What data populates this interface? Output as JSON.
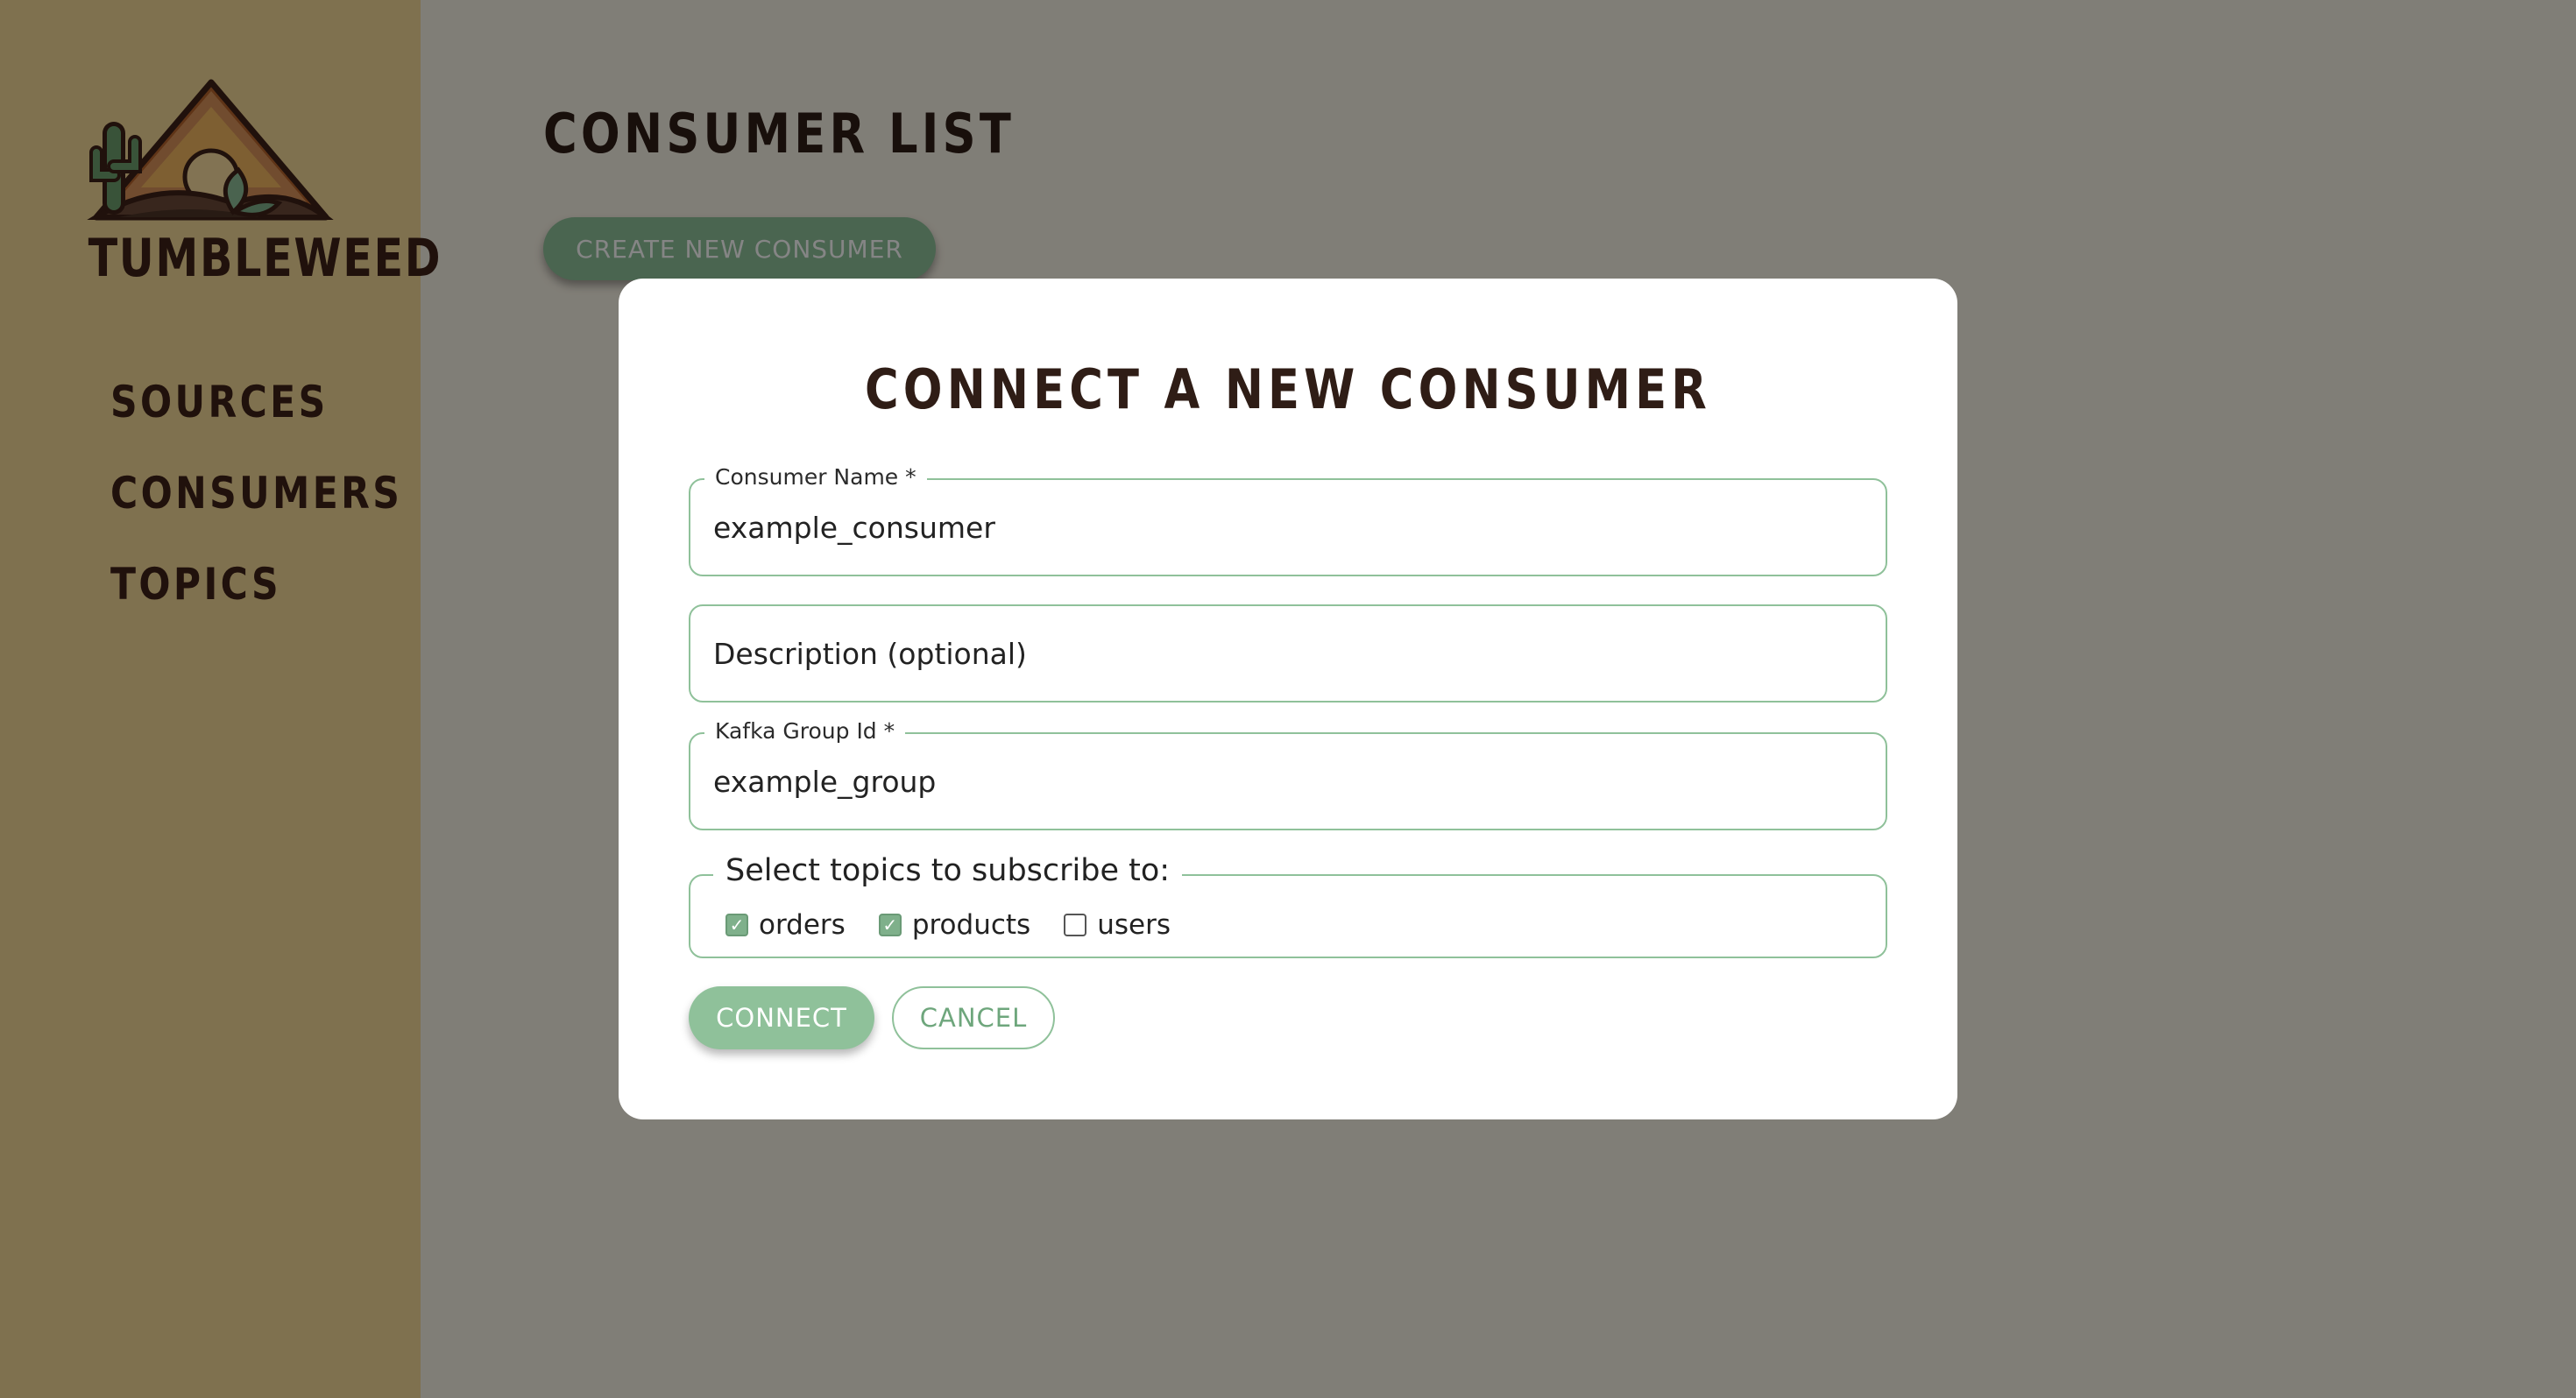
{
  "app": {
    "brand": "TUMBLEWEED",
    "logo_icon": "tumbleweed-desert-logo"
  },
  "sidebar": {
    "items": [
      {
        "label": "SOURCES"
      },
      {
        "label": "CONSUMERS"
      },
      {
        "label": "TOPICS"
      }
    ]
  },
  "main": {
    "title": "CONSUMER LIST",
    "create_button": "CREATE NEW CONSUMER"
  },
  "modal": {
    "title": "CONNECT A NEW CONSUMER",
    "consumer_name": {
      "label": "Consumer Name *",
      "value": "example_consumer"
    },
    "description": {
      "placeholder": "Description (optional)",
      "value": ""
    },
    "kafka_group": {
      "label": "Kafka Group Id *",
      "value": "example_group"
    },
    "topics_legend": "Select topics to subscribe to:",
    "topics": [
      {
        "name": "orders",
        "checked": true
      },
      {
        "name": "products",
        "checked": true
      },
      {
        "name": "users",
        "checked": false
      }
    ],
    "connect_button": "CONNECT",
    "cancel_button": "CANCEL"
  },
  "colors": {
    "sidebar_bg": "#f4d997",
    "page_bg": "#f6f1e4",
    "accent_green": "#8fc19a",
    "title_brown": "#2f1d16",
    "overlay": "rgba(0,0,0,0.48)"
  }
}
